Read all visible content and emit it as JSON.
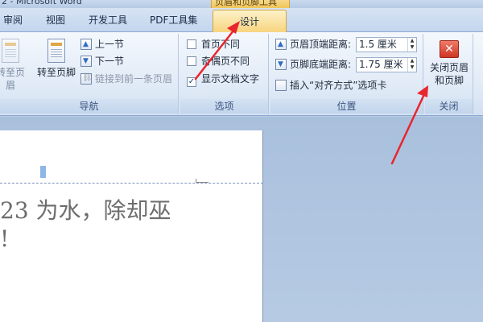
{
  "window": {
    "title": "2 - Microsoft Word",
    "context_title": "页眉和页脚工具"
  },
  "tabs": [
    {
      "label": "审阅"
    },
    {
      "label": "视图"
    },
    {
      "label": "开发工具"
    },
    {
      "label": "PDF工具集"
    },
    {
      "label": "设计",
      "active": true
    }
  ],
  "nav": {
    "goto_header": "转至页眉",
    "goto_footer": "转至页脚",
    "prev_section": "上一节",
    "next_section": "下一节",
    "link_previous": "链接到前一条页眉",
    "label": "导航"
  },
  "options": {
    "items": [
      {
        "label": "首页不同",
        "checked": false
      },
      {
        "label": "奇偶页不同",
        "checked": false
      },
      {
        "label": "显示文档文字",
        "checked": true
      }
    ],
    "label": "选项"
  },
  "position": {
    "header_top_label": "页眉顶端距离:",
    "header_top_value": "1.5 厘米",
    "footer_bottom_label": "页脚底端距离:",
    "footer_bottom_value": "1.75 厘米",
    "insert_align_tab": "插入“对齐方式”选项卡",
    "label": "位置"
  },
  "close": {
    "button_line1": "关闭页眉",
    "button_line2": "和页脚",
    "label": "关闭"
  },
  "document": {
    "line1": "23 为水，除却巫",
    "line2": "!"
  },
  "colors": {
    "active_tab": "#f7d37c",
    "annotation_arrow": "#e8262e",
    "close_icon": "#cf3626"
  }
}
